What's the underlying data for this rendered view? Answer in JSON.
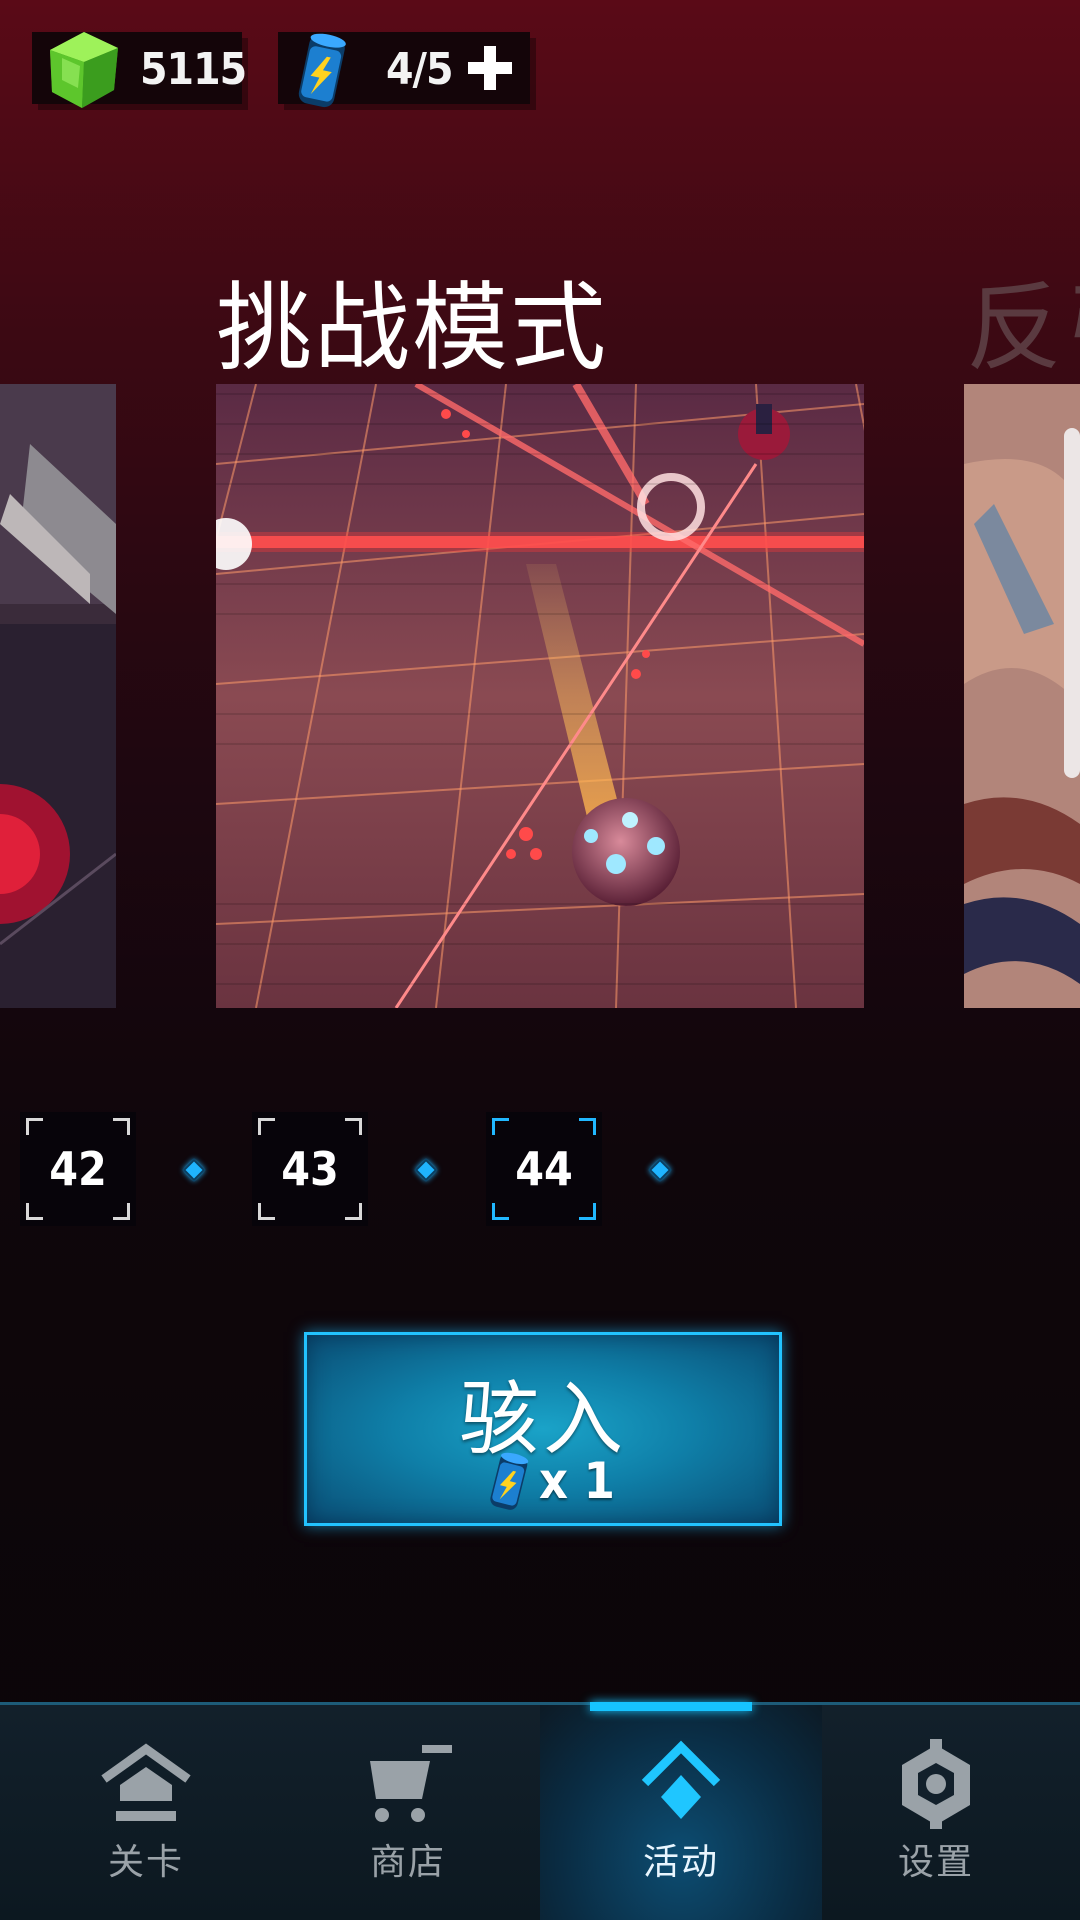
{
  "resources": {
    "gems": "5115",
    "energy": "4/5"
  },
  "carousel": {
    "current_title": "挑战模式",
    "next_title_partial": "反弓"
  },
  "levels": [
    {
      "number": "42",
      "selected": false
    },
    {
      "number": "43",
      "selected": false
    },
    {
      "number": "44",
      "selected": true
    }
  ],
  "enter_button": {
    "label": "骇入",
    "cost": "x 1"
  },
  "nav": {
    "items": [
      {
        "label": "关卡",
        "icon": "home-icon"
      },
      {
        "label": "商店",
        "icon": "cart-icon"
      },
      {
        "label": "活动",
        "icon": "event-diamond-icon"
      },
      {
        "label": "设置",
        "icon": "gear-icon"
      }
    ],
    "active_index": 2
  },
  "colors": {
    "accent": "#16c4ff",
    "gem": "#6fd43a",
    "background_top": "#5a0a17"
  }
}
